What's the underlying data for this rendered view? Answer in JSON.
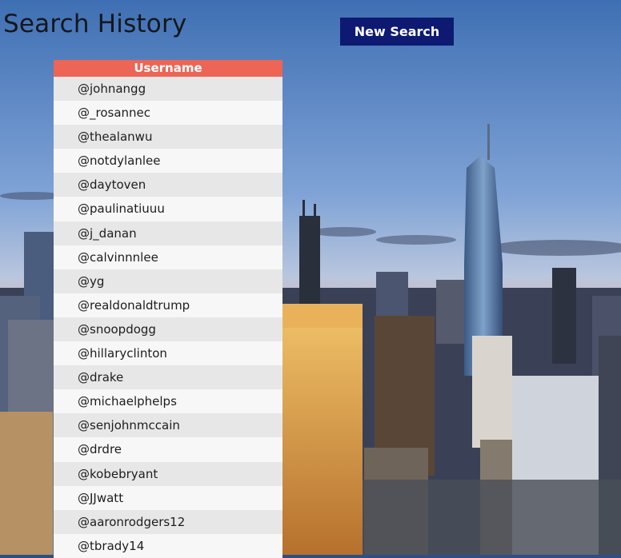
{
  "header": {
    "title": "Search History",
    "new_search_label": "New Search"
  },
  "table": {
    "column_header": "Username",
    "rows": [
      "@johnangg",
      "@_rosannec",
      "@thealanwu",
      "@notdylanlee",
      "@daytoven",
      "@paulinatiuuu",
      "@j_danan",
      "@calvinnnlee",
      "@yg",
      "@realdonaldtrump",
      "@snoopdogg",
      "@hillaryclinton",
      "@drake",
      "@michaelphelps",
      "@senjohnmccain",
      "@drdre",
      "@kobebryant",
      "@JJwatt",
      "@aaronrodgers12",
      "@tbrady14"
    ]
  },
  "colors": {
    "button": "#0e1a72",
    "table_header": "#ec6555",
    "row_odd": "#e7e7e7",
    "row_even": "#f7f7f7"
  }
}
